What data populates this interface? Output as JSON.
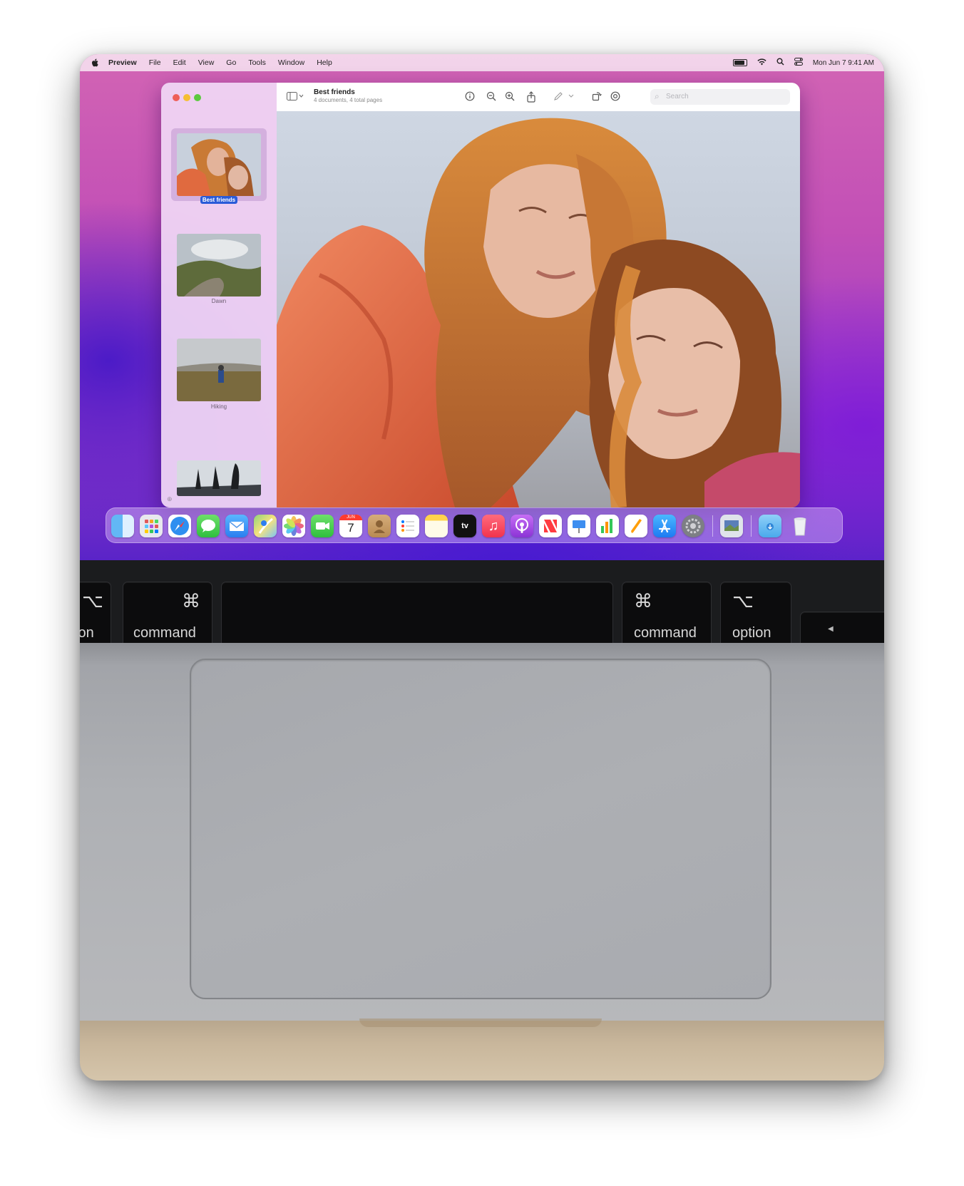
{
  "menubar": {
    "apple_icon": "apple-logo-icon",
    "app_name": "Preview",
    "items": [
      "File",
      "Edit",
      "View",
      "Go",
      "Tools",
      "Window",
      "Help"
    ],
    "datetime": "Mon Jun 7  9:41 AM",
    "status_icons": [
      "battery-icon",
      "wifi-icon",
      "spotlight-search-icon",
      "control-center-icon"
    ]
  },
  "preview": {
    "title": "Best friends",
    "subtitle": "4 documents, 4 total pages",
    "search_placeholder": "Search",
    "toolbar_icons": [
      "sidebar-toggle-icon",
      "info-icon",
      "zoom-out-icon",
      "zoom-in-icon",
      "share-icon",
      "markup-pen-icon",
      "rotate-icon",
      "annotate-icon"
    ],
    "thumbnails": [
      {
        "label": "Best friends",
        "selected": true
      },
      {
        "label": "Dawn",
        "selected": false
      },
      {
        "label": "Hiking",
        "selected": false
      },
      {
        "label": "",
        "selected": false
      }
    ]
  },
  "dock": {
    "apps": [
      "Finder",
      "Launchpad",
      "Safari",
      "Messages",
      "Mail",
      "Maps",
      "Photos",
      "FaceTime",
      "Calendar",
      "Contacts",
      "Reminders",
      "Notes",
      "TV",
      "Music",
      "Podcasts",
      "News",
      "Keynote",
      "Numbers",
      "Pages",
      "App Store",
      "System Preferences",
      "Preview",
      "Downloads",
      "Trash"
    ],
    "calendar_month": "JUN",
    "calendar_day": "7",
    "tv_label": "tv"
  },
  "keyboard": {
    "keys": [
      {
        "symbol": "⌥",
        "label": "ion"
      },
      {
        "symbol": "⌘",
        "label": "command"
      },
      {
        "symbol": "",
        "label": ""
      },
      {
        "symbol": "⌘",
        "label": "command"
      },
      {
        "symbol": "⌥",
        "label": "option"
      }
    ]
  },
  "colors": {
    "accent_selection": "#2a5bd8",
    "wallpaper_pink": "#d264b4",
    "wallpaper_purple": "#5a24c8",
    "key_black": "#0c0c0d",
    "aluminum": "#aeb0b4"
  }
}
